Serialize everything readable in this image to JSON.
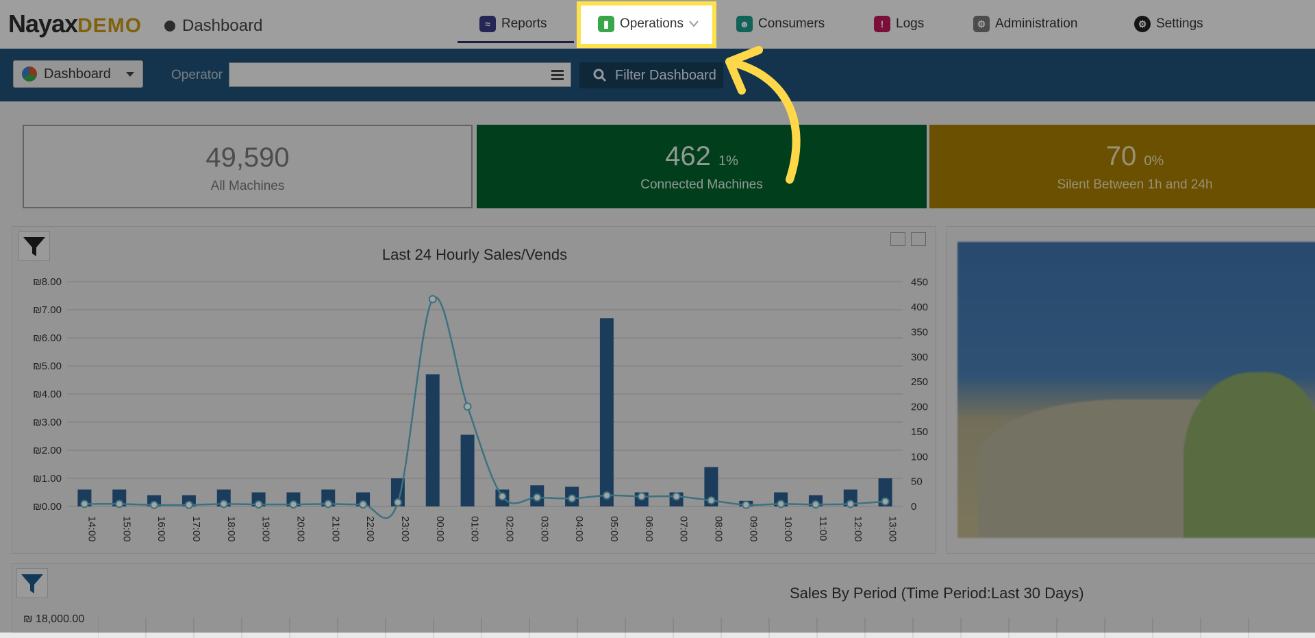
{
  "brand": {
    "name": "Nayax",
    "suffix": "DEMO"
  },
  "breadcrumb": {
    "label": "Dashboard"
  },
  "nav": {
    "reports": {
      "label": "Reports",
      "icon": "reports-icon",
      "color": "#3a3c86"
    },
    "operations": {
      "label": "Operations",
      "icon": "operations-icon",
      "color": "#3aa64a"
    },
    "consumers": {
      "label": "Consumers",
      "icon": "consumers-icon",
      "color": "#1b9c8c"
    },
    "logs": {
      "label": "Logs",
      "icon": "logs-icon",
      "color": "#c2185b"
    },
    "administration": {
      "label": "Administration",
      "icon": "administration-icon",
      "color": "#777777"
    },
    "settings": {
      "label": "Settings",
      "icon": "settings-icon",
      "color": "#222222"
    }
  },
  "filterbar": {
    "dashboard_label": "Dashboard",
    "operator_label": "Operator",
    "operator_value": "",
    "filter_button": "Filter Dashboard"
  },
  "stats": [
    {
      "value": "49,590",
      "pct": "",
      "label": "All Machines"
    },
    {
      "value": "462",
      "pct": "1%",
      "label": "Connected Machines"
    },
    {
      "value": "70",
      "pct": "0%",
      "label": "Silent Between 1h and 24h"
    }
  ],
  "highlight": {
    "color": "#ffe14a",
    "target": "Operations"
  },
  "chart_data": {
    "type": "bar",
    "title": "Last 24 Hourly Sales/Vends",
    "categories": [
      "14:00",
      "15:00",
      "16:00",
      "17:00",
      "18:00",
      "19:00",
      "20:00",
      "21:00",
      "22:00",
      "23:00",
      "00:00",
      "01:00",
      "02:00",
      "03:00",
      "04:00",
      "05:00",
      "06:00",
      "07:00",
      "08:00",
      "09:00",
      "10:00",
      "11:00",
      "12:00",
      "13:00"
    ],
    "series": [
      {
        "type": "bar",
        "axis": "left",
        "values": [
          0.6,
          0.6,
          0.4,
          0.4,
          0.6,
          0.5,
          0.5,
          0.6,
          0.5,
          1.0,
          4.7,
          2.55,
          0.6,
          0.75,
          0.7,
          6.7,
          0.5,
          0.5,
          1.4,
          0.2,
          0.5,
          0.4,
          0.6,
          1.0
        ]
      },
      {
        "type": "line",
        "axis": "right",
        "values": [
          5,
          5,
          3,
          3,
          5,
          4,
          4,
          5,
          4,
          8,
          415,
          200,
          20,
          18,
          16,
          22,
          20,
          20,
          12,
          3,
          5,
          4,
          5,
          10
        ]
      }
    ],
    "yticks_left": [
      "₪0.00",
      "₪1.00",
      "₪2.00",
      "₪3.00",
      "₪4.00",
      "₪5.00",
      "₪6.00",
      "₪7.00",
      "₪8.00"
    ],
    "ylim_left": [
      0,
      8
    ],
    "yticks_right": [
      "0",
      "50",
      "100",
      "150",
      "200",
      "250",
      "300",
      "350",
      "400",
      "450"
    ],
    "ylim_right": [
      0,
      450
    ],
    "grid": true,
    "colors": {
      "bar": "#2b5f8f",
      "line": "#5fb3c9"
    }
  },
  "bottom_chart": {
    "title": "Sales By Period (Time Period:Last 30 Days)",
    "y_top_label": "₪ 18,000.00"
  }
}
